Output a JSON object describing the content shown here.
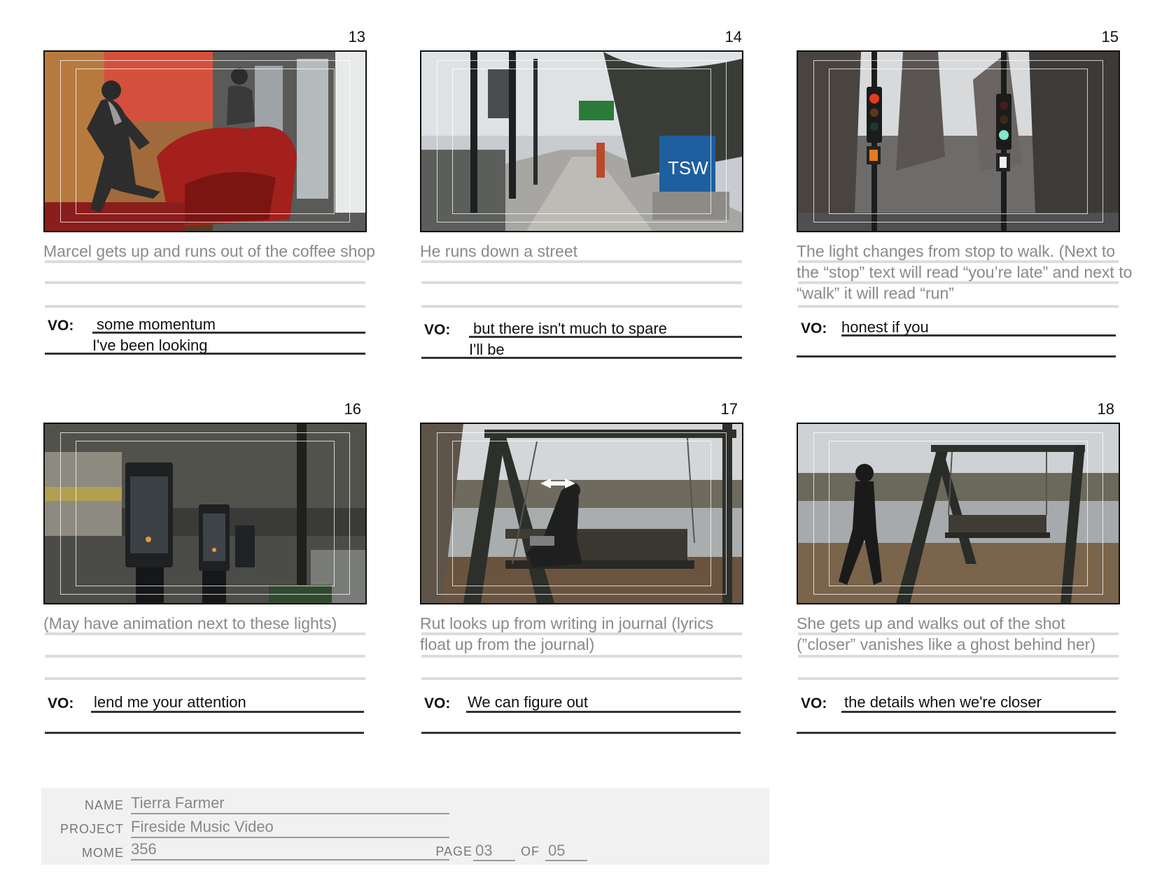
{
  "panels": [
    {
      "number": "13",
      "description": "Marcel gets up and runs out of the coffee shop",
      "vo_label": "VO:",
      "vo_lines": [
        "some momentum",
        "I've been looking"
      ]
    },
    {
      "number": "14",
      "description": "He runs down a street",
      "vo_label": "VO:",
      "vo_lines": [
        "but there isn't much to spare",
        "I'll be"
      ]
    },
    {
      "number": "15",
      "description": "The light changes from stop to walk.  (Next to  the “stop”  text will read “you’re late” and next to “walk” it will read “run”",
      "vo_label": "VO:",
      "vo_lines": [
        "honest if you",
        ""
      ]
    },
    {
      "number": "16",
      "description": "(May have animation next to these lights)",
      "vo_label": "VO:",
      "vo_lines": [
        "lend me your attention",
        ""
      ]
    },
    {
      "number": "17",
      "description": "Rut looks up from writing in journal (lyrics float up from the journal)",
      "vo_label": "VO:",
      "vo_lines": [
        "We can figure out",
        ""
      ]
    },
    {
      "number": "18",
      "description": "She gets up and walks out of the shot (”closer” vanishes like a ghost behind her)",
      "vo_label": "VO:",
      "vo_lines": [
        "the details when we're closer",
        ""
      ]
    }
  ],
  "footer": {
    "name_label": "NAME",
    "name_value": "Tierra Farmer",
    "project_label": "PROJECT",
    "project_value": "Fireside Music Video",
    "mome_label": "MOME",
    "mome_value": "356",
    "page_label": "PAGE",
    "page_value": "03",
    "of_label": "OF",
    "of_value": "05"
  },
  "frame_images": {
    "13": "tsw-sign-text",
    "14": "TSW"
  }
}
